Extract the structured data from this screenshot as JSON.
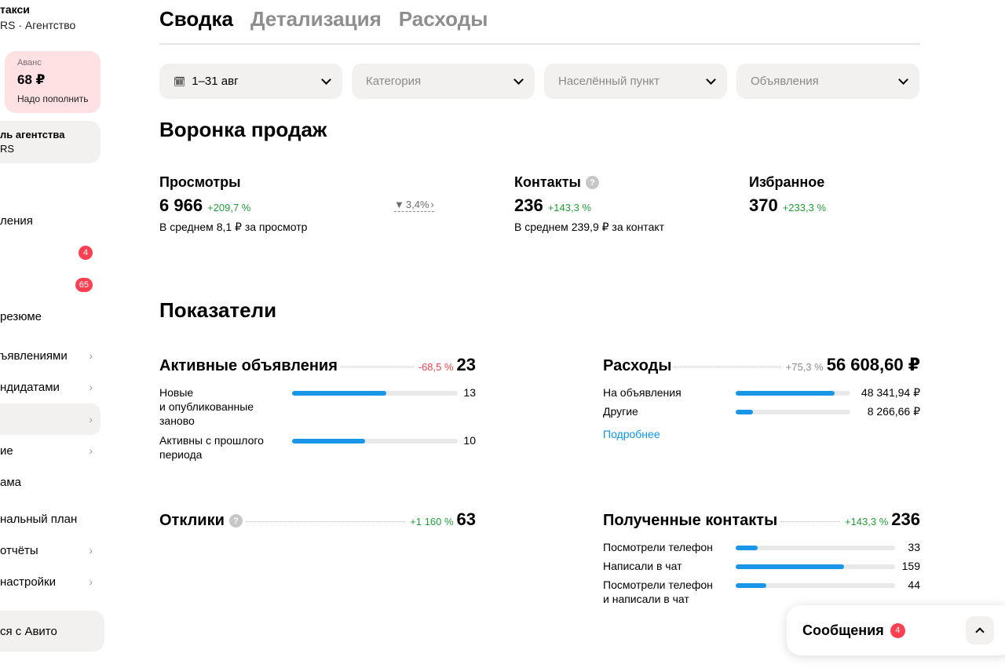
{
  "sidebar": {
    "title": "такси",
    "subtitle": "RS · Агентство",
    "advance": {
      "label": "Аванс",
      "amount": "68 ₽",
      "note": "Надо пополнить"
    },
    "agency_card": {
      "line1": "ль агентства",
      "line2": "RS"
    },
    "items": [
      {
        "label": "ления",
        "badge": "",
        "chevron": false,
        "selected": false
      },
      {
        "label": "",
        "badge": "4",
        "chevron": false,
        "selected": false
      },
      {
        "label": "",
        "badge": "65",
        "chevron": false,
        "selected": false
      },
      {
        "label": "резюме",
        "badge": "",
        "chevron": false,
        "selected": false
      },
      {
        "label": "ъявлениями",
        "badge": "",
        "chevron": true,
        "selected": false
      },
      {
        "label": "ндидатами",
        "badge": "",
        "chevron": true,
        "selected": false
      },
      {
        "label": "",
        "badge": "",
        "chevron": true,
        "selected": true
      },
      {
        "label": "ие",
        "badge": "",
        "chevron": true,
        "selected": false
      },
      {
        "label": "ама",
        "badge": "",
        "chevron": false,
        "selected": false
      },
      {
        "label": "нальный план",
        "badge": "",
        "chevron": false,
        "selected": false
      },
      {
        "label": "отчёты",
        "badge": "",
        "chevron": true,
        "selected": false
      },
      {
        "label": "настройки",
        "badge": "",
        "chevron": true,
        "selected": false
      }
    ],
    "contact": "ся с Авито"
  },
  "tabs": [
    "Сводка",
    "Детализация",
    "Расходы"
  ],
  "filters": {
    "date": "1–31 авг",
    "category": "Категория",
    "locality": "Населённый пункт",
    "ads": "Объявления"
  },
  "funnel": {
    "title": "Воронка продаж",
    "views": {
      "title": "Просмотры",
      "value": "6 966",
      "change": "+209,7 %",
      "avg": "В среднем 8,1 ₽ за просмотр"
    },
    "conversion": "3,4%",
    "contacts": {
      "title": "Контакты",
      "value": "236",
      "change": "+143,3 %",
      "avg": "В среднем 239,9 ₽ за контакт"
    },
    "favorites": {
      "title": "Избранное",
      "value": "370",
      "change": "+233,3 %"
    }
  },
  "indicators": {
    "title": "Показатели",
    "active_ads": {
      "title": "Активные объявления",
      "change": "-68,5 %",
      "value": "23",
      "rows": [
        {
          "label": "Новые\nи опубликованные\nзаново",
          "value": "13",
          "fill": 0.57
        },
        {
          "label": "Активны с прошлого\nпериода",
          "value": "10",
          "fill": 0.44
        }
      ]
    },
    "expenses": {
      "title": "Расходы",
      "change": "+75,3 %",
      "value": "56 608,60 ₽",
      "rows": [
        {
          "label": "На объявления",
          "value": "48 341,94 ₽",
          "fill": 0.86
        },
        {
          "label": "Другие",
          "value": "8 266,66 ₽",
          "fill": 0.15
        }
      ],
      "more": "Подробнее"
    },
    "responses": {
      "title": "Отклики",
      "change": "+1 160 %",
      "value": "63"
    },
    "received_contacts": {
      "title": "Полученные контакты",
      "change": "+143,3 %",
      "value": "236",
      "rows": [
        {
          "label": "Посмотрели телефон",
          "value": "33",
          "fill": 0.14
        },
        {
          "label": "Написали в чат",
          "value": "159",
          "fill": 0.68
        },
        {
          "label": "Посмотрели телефон\nи написали в чат",
          "value": "44",
          "fill": 0.19
        }
      ]
    }
  },
  "messages": {
    "label": "Сообщения",
    "badge": "4"
  },
  "colors": {
    "accent_blue": "#1a96e8",
    "badge_red": "#ff4053",
    "positive": "#21a038",
    "negative": "#f0444f",
    "advance_bg": "#ffe1e3"
  }
}
